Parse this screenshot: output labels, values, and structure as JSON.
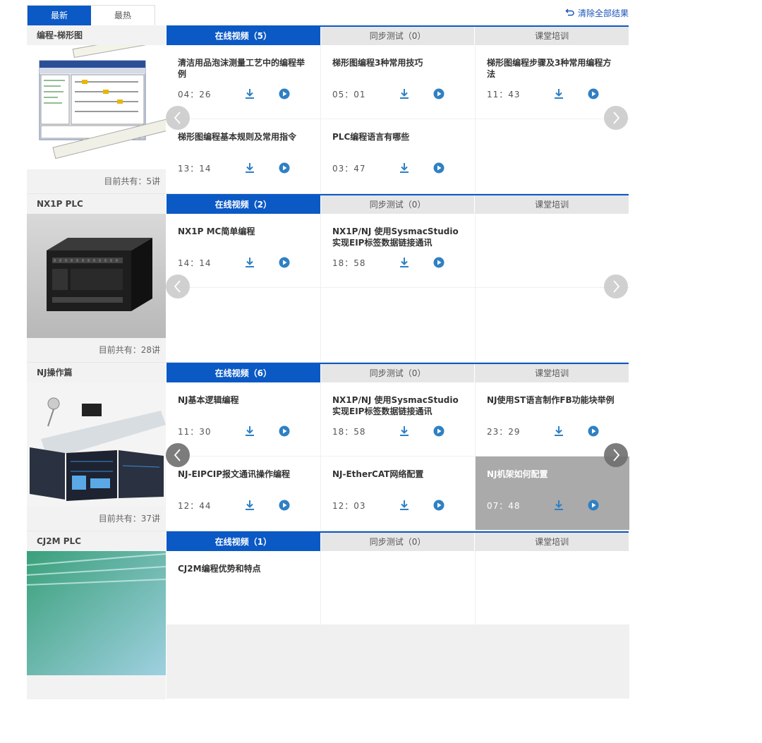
{
  "sort_tabs": [
    {
      "label": "最新",
      "active": true
    },
    {
      "label": "最热",
      "active": false
    }
  ],
  "clear_label": "清除全部结果",
  "colors": {
    "accent": "#0b59c5",
    "icon": "#2f80c4",
    "highlight": "#aaaaaa"
  },
  "courses": [
    {
      "name": "编程-梯形图",
      "count": "目前共有：5讲",
      "tabs": [
        "在线视频（5）",
        "同步测试（0）",
        "课堂培训"
      ],
      "arrow_style": "light",
      "lessons": [
        {
          "title": "清洁用品泡沫测量工艺中的编程举例",
          "duration": "04：26"
        },
        {
          "title": "梯形图编程3种常用技巧",
          "duration": "05：01"
        },
        {
          "title": "梯形图编程步骤及3种常用编程方法",
          "duration": "11：43"
        },
        {
          "title": "梯形图编程基本规则及常用指令",
          "duration": "13：14"
        },
        {
          "title": "PLC编程语言有哪些",
          "duration": "03：47"
        }
      ]
    },
    {
      "name": "NX1P PLC",
      "count": "目前共有：28讲",
      "tabs": [
        "在线视频（2）",
        "同步测试（0）",
        "课堂培训"
      ],
      "arrow_style": "light",
      "lessons": [
        {
          "title": "NX1P MC简单编程",
          "duration": "14：14"
        },
        {
          "title": "NX1P/NJ 使用SysmacStudio实现EIP标签数据链接通讯",
          "duration": "18：58"
        }
      ]
    },
    {
      "name": "NJ操作篇",
      "count": "目前共有：37讲",
      "tabs": [
        "在线视频（6）",
        "同步测试（0）",
        "课堂培训"
      ],
      "arrow_style": "dark",
      "lessons": [
        {
          "title": "NJ基本逻辑编程",
          "duration": "11：30"
        },
        {
          "title": "NX1P/NJ 使用SysmacStudio实现EIP标签数据链接通讯",
          "duration": "18：58"
        },
        {
          "title": "NJ使用ST语言制作FB功能块举例",
          "duration": "23：29"
        },
        {
          "title": "NJ-EIPCIP报文通讯操作编程",
          "duration": "12：44"
        },
        {
          "title": "NJ-EtherCAT网络配置",
          "duration": "12：03"
        },
        {
          "title": "NJ机架如何配置",
          "duration": "07：48",
          "highlighted": true
        }
      ]
    },
    {
      "name": "CJ2M PLC",
      "count": "",
      "tabs": [
        "在线视频（1）",
        "同步测试（0）",
        "课堂培训"
      ],
      "arrow_style": "none",
      "lessons": [
        {
          "title": "CJ2M编程优势和特点",
          "duration": ""
        }
      ]
    }
  ]
}
